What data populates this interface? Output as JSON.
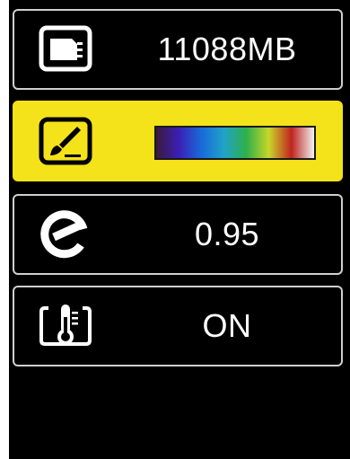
{
  "settings": {
    "storage": {
      "icon": "sd-card-icon",
      "value": "11088MB"
    },
    "palette": {
      "icon": "paint-brush-icon",
      "selected": true,
      "highlight_color": "#f4e21a",
      "gradient_colors": [
        "#3a1a3a",
        "#3b1fb5",
        "#1a6ad8",
        "#1fa2c8",
        "#2fb04a",
        "#c8d629",
        "#c0241f",
        "#f2f2f2"
      ]
    },
    "emissivity": {
      "icon": "emissivity-icon",
      "value": "0.95"
    },
    "temperature": {
      "icon": "thermometer-icon",
      "value": "ON"
    }
  }
}
